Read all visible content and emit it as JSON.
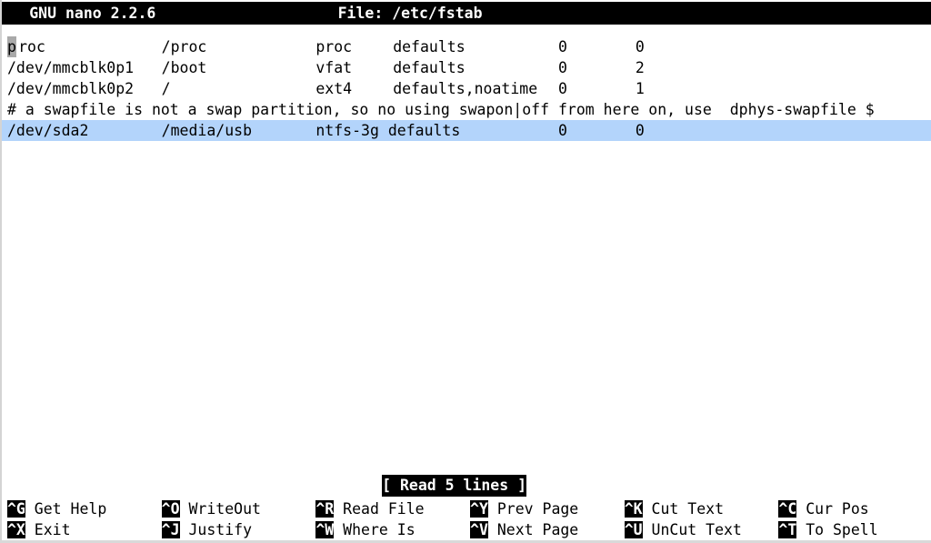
{
  "app": {
    "title": "GNU nano 2.2.6",
    "file_label": "File: /etc/fstab"
  },
  "editor": {
    "cursor_char": "p",
    "lines": [
      {
        "id": "line-proc",
        "selected": false,
        "cursor": true,
        "segments": [
          {
            "col": 0,
            "text": "proc"
          },
          {
            "col": 14,
            "text": "/proc"
          },
          {
            "col": 28,
            "text": "proc"
          },
          {
            "col": 35,
            "text": "defaults"
          },
          {
            "col": 50,
            "text": "0"
          },
          {
            "col": 57,
            "text": "0"
          }
        ],
        "raw": "proc          /proc         proc   defaults       0      0"
      },
      {
        "id": "line-boot",
        "selected": false,
        "cursor": false,
        "segments": [
          {
            "col": 0,
            "text": "/dev/mmcblk0p1"
          },
          {
            "col": 14,
            "text": "/boot"
          },
          {
            "col": 28,
            "text": "vfat"
          },
          {
            "col": 35,
            "text": "defaults"
          },
          {
            "col": 50,
            "text": "0"
          },
          {
            "col": 57,
            "text": "2"
          }
        ],
        "raw": "/dev/mmcblk0p1 /boot        vfat   defaults       0      2"
      },
      {
        "id": "line-root",
        "selected": false,
        "cursor": false,
        "segments": [
          {
            "col": 0,
            "text": "/dev/mmcblk0p2"
          },
          {
            "col": 14,
            "text": "/"
          },
          {
            "col": 28,
            "text": "ext4"
          },
          {
            "col": 35,
            "text": "defaults,noatime"
          },
          {
            "col": 50,
            "text": "0"
          },
          {
            "col": 57,
            "text": "1"
          }
        ],
        "raw": "/dev/mmcblk0p2 /            ext4   defaults,noatime 0    1"
      },
      {
        "id": "line-comment",
        "selected": false,
        "cursor": false,
        "segments": [
          {
            "col": 0,
            "text": "# a swapfile is not a swap partition, so no using swapon|off from here on, use  dphys-swapfile $"
          }
        ],
        "raw": "# a swapfile is not a swap partition, so no using swapon|off from here on, use  dphys-swapfile $"
      },
      {
        "id": "line-sda2",
        "selected": true,
        "cursor": false,
        "segments": [
          {
            "col": 0,
            "text": "/dev/sda2"
          },
          {
            "col": 14,
            "text": "/media/usb"
          },
          {
            "col": 28,
            "text": "ntfs-3g defaults"
          },
          {
            "col": 50,
            "text": "0"
          },
          {
            "col": 57,
            "text": "0"
          }
        ],
        "raw": "/dev/sda2     /media/usb    ntfs-3g defaults     0      0"
      }
    ]
  },
  "status": {
    "message": "[ Read 5 lines ]"
  },
  "shortcuts": {
    "row1": [
      {
        "col": 0,
        "key": "^G",
        "label": " Get Help"
      },
      {
        "col": 14,
        "key": "^O",
        "label": " WriteOut"
      },
      {
        "col": 28,
        "key": "^R",
        "label": " Read File"
      },
      {
        "col": 42,
        "key": "^Y",
        "label": " Prev Page"
      },
      {
        "col": 56,
        "key": "^K",
        "label": " Cut Text"
      },
      {
        "col": 70,
        "key": "^C",
        "label": " Cur Pos"
      }
    ],
    "row2": [
      {
        "col": 0,
        "key": "^X",
        "label": " Exit"
      },
      {
        "col": 14,
        "key": "^J",
        "label": " Justify"
      },
      {
        "col": 28,
        "key": "^W",
        "label": " Where Is"
      },
      {
        "col": 42,
        "key": "^V",
        "label": " Next Page"
      },
      {
        "col": 56,
        "key": "^U",
        "label": " UnCut Text"
      },
      {
        "col": 70,
        "key": "^T",
        "label": " To Spell"
      }
    ]
  },
  "colors": {
    "selection": "#b3d4fb",
    "inverse_bg": "#000000",
    "inverse_fg": "#ffffff",
    "cursor_block": "#a9a9a9"
  }
}
